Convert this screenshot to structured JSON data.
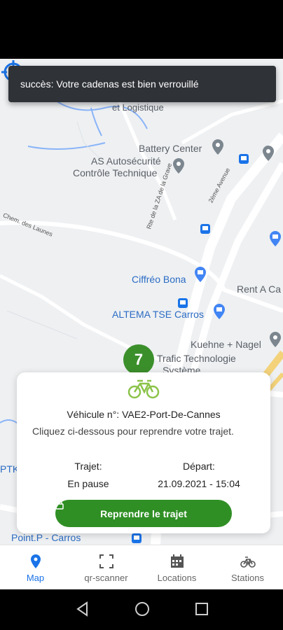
{
  "status_bar": {
    "left": "",
    "right": ""
  },
  "toast": {
    "message": "succès: Votre cadenas est bien  verrouillé"
  },
  "map": {
    "labels": {
      "logistique": "et Logistique",
      "battery": "Battery Center",
      "as_auto_1": "AS Autosécurité",
      "as_auto_2": "Contrôle Technique",
      "chem_launes": "Chem. des Launes",
      "rte_za": "Rte de la ZA de la Grave",
      "avenue_2e": "2ème Avenue",
      "ciffreo": "Ciffréo Bona",
      "rent": "Rent A Ca",
      "altema": "ALTEMA TSE Carros",
      "kuehne": "Kuehne + Nagel",
      "trafic_1": "Trafic Technologie",
      "trafic_2": "Système",
      "pointp": "Point.P - Carros",
      "ptk": "PTK"
    },
    "marker_count": "7"
  },
  "card": {
    "vehicle": "Véhicule n°: VAE2-Port-De-Cannes",
    "hint": "Cliquez ci-dessous pour reprendre votre trajet.",
    "trajet_label": "Trajet:",
    "trajet_value": "En pause",
    "depart_label": "Départ:",
    "depart_value": "21.09.2021 - 15:04",
    "resume_button": "Reprendre le trajet"
  },
  "nav": {
    "items": [
      {
        "label": "Map",
        "icon": "map-pin-icon",
        "active": true
      },
      {
        "label": "qr-scanner",
        "icon": "scan-icon",
        "active": false
      },
      {
        "label": "Locations",
        "icon": "calendar-icon",
        "active": false
      },
      {
        "label": "Stations",
        "icon": "bicycle-icon",
        "active": false
      }
    ]
  },
  "colors": {
    "accent": "#1a73e8",
    "green": "#2f8f24",
    "toast": "#2f3237"
  }
}
